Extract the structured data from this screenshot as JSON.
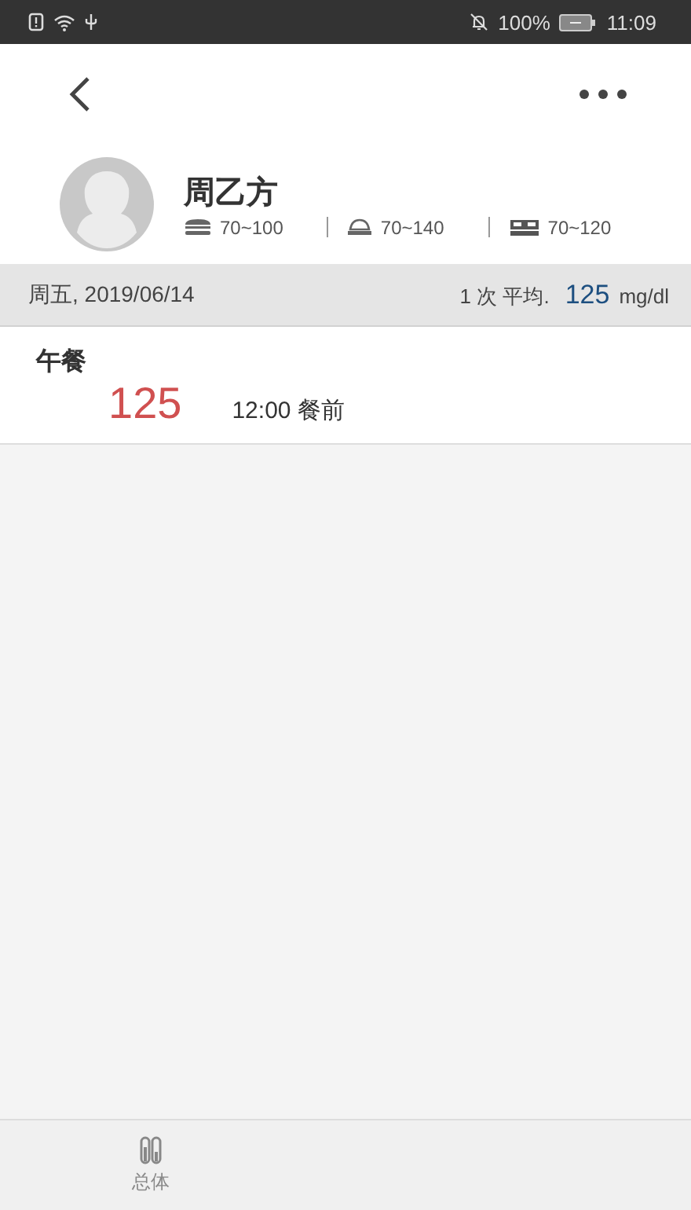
{
  "status_bar": {
    "battery": "100%",
    "time": "11:09"
  },
  "profile": {
    "name": "周乙方",
    "ranges": [
      {
        "kind": "fasting",
        "text": "70~100"
      },
      {
        "kind": "after-meal",
        "text": "70~140"
      },
      {
        "kind": "bedtime",
        "text": "70~120"
      }
    ]
  },
  "day": {
    "date": "周五, 2019/06/14",
    "count": "1 次 平均.",
    "average": "125",
    "unit": "mg/dl"
  },
  "readings": [
    {
      "meal": "午餐",
      "value": "125",
      "time": "12:00 餐前"
    }
  ],
  "bottom_nav": [
    {
      "label": "总体"
    }
  ]
}
